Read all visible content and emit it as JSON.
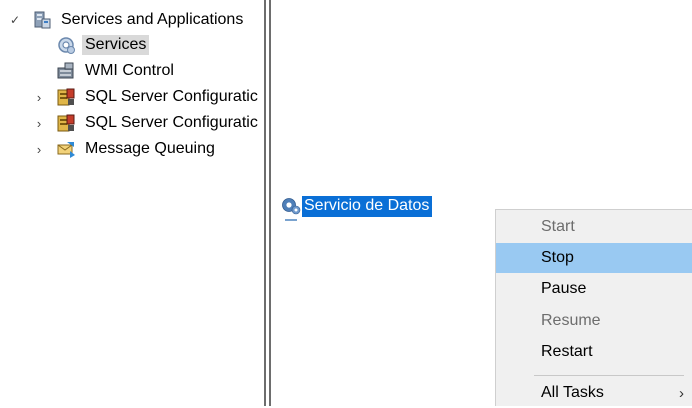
{
  "tree": {
    "items": [
      {
        "label": "Services and Applications",
        "chevron": "✓",
        "icon": "services-applications-icon"
      },
      {
        "label": "Services",
        "chevron": "",
        "icon": "services-gear-icon",
        "selected": true
      },
      {
        "label": "WMI Control",
        "chevron": "",
        "icon": "wmi-control-icon"
      },
      {
        "label": "SQL Server Configuratic",
        "chevron": "›",
        "icon": "sql-config-icon"
      },
      {
        "label": "SQL Server Configuratic",
        "chevron": "›",
        "icon": "sql-config-icon"
      },
      {
        "label": "Message Queuing",
        "chevron": "›",
        "icon": "message-queue-icon"
      }
    ]
  },
  "services_list": {
    "selected_service": "Servicio de Datos"
  },
  "context_menu": {
    "items": [
      {
        "label": "Start",
        "enabled": false
      },
      {
        "label": "Stop",
        "enabled": true,
        "highlighted": true
      },
      {
        "label": "Pause",
        "enabled": true
      },
      {
        "label": "Resume",
        "enabled": false
      },
      {
        "label": "Restart",
        "enabled": true
      },
      {
        "label": "All Tasks",
        "enabled": true,
        "submenu": "›"
      }
    ]
  },
  "colors": {
    "selection_blue": "#0a6fd6",
    "menu_highlight": "#99c9f2",
    "menu_background": "#f0f0f0",
    "tree_selection": "#d9d9d9"
  }
}
